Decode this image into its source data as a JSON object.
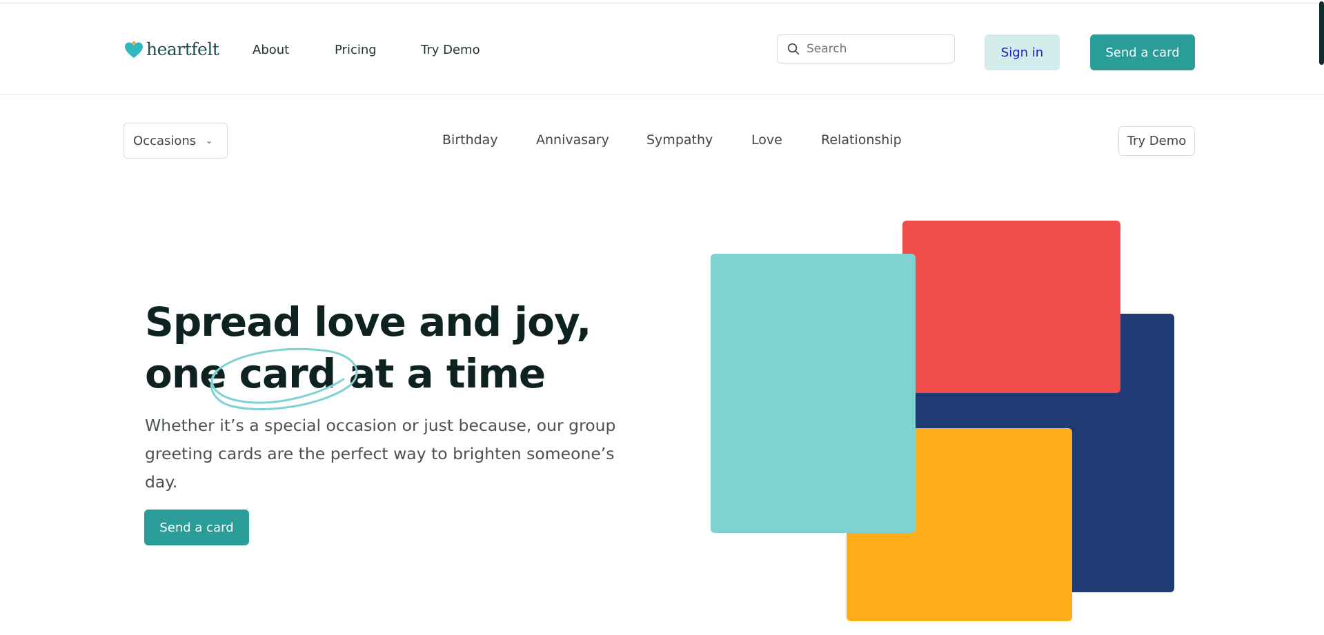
{
  "header": {
    "logo_text": "heartfelt",
    "nav": [
      "About",
      "Pricing",
      "Try Demo"
    ],
    "search_placeholder": "Search",
    "signin_label": "Sign in",
    "send_label": "Send a card"
  },
  "subnav": {
    "occasions_label": "Occasions",
    "categories": [
      "Birthday",
      "Annivasary",
      "Sympathy",
      "Love",
      "Relationship"
    ],
    "try_demo_label": "Try Demo"
  },
  "hero": {
    "title_line1": "Spread love and joy,",
    "title_line2": "one card at a time",
    "subtitle": "Whether it’s a special occasion or just because, our group greeting cards are the perfect way to brighten someone’s day.",
    "cta_label": "Send a card"
  },
  "colors": {
    "brand_teal": "#2a9d98",
    "card_teal": "#7fd1d2",
    "card_red": "#f24d4d",
    "card_navy": "#203a73",
    "card_yellow": "#feae1a",
    "heart_teal": "#33b7be",
    "heart_dot": "#f4a63a"
  },
  "icons": {
    "logo": "heart-logo-icon",
    "search": "search-icon",
    "occasions": "chevron-down-icon"
  }
}
